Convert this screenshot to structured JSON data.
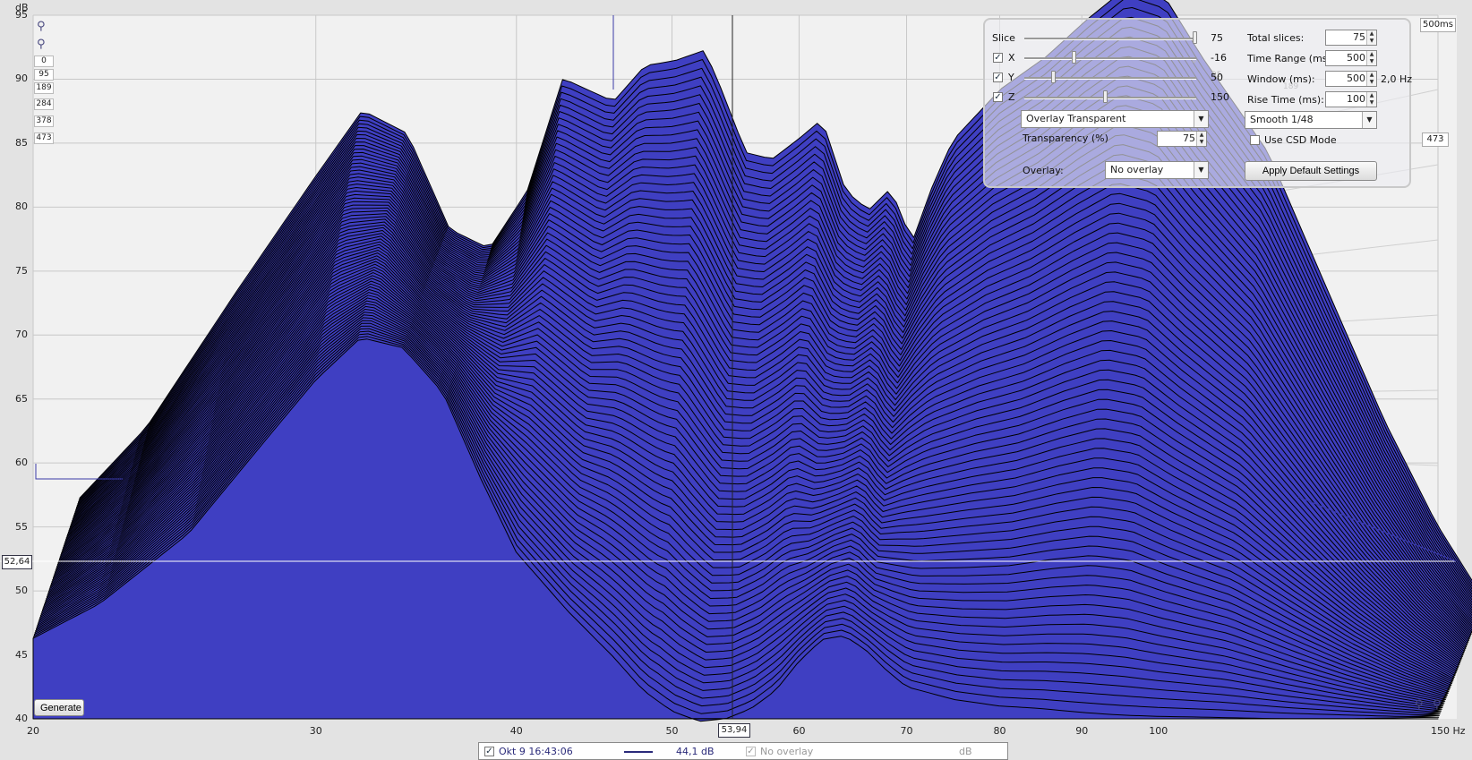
{
  "axes": {
    "y_unit": "dB",
    "y_ticks": [
      "95",
      "90",
      "85",
      "80",
      "75",
      "70",
      "65",
      "60",
      "55",
      "50",
      "45",
      "40"
    ],
    "x_ticks": [
      "20",
      "30",
      "40",
      "50",
      "60",
      "70",
      "80",
      "90",
      "100",
      "150 Hz"
    ],
    "cursor_y": "52,64",
    "cursor_x": "53,94",
    "time_label": "500ms"
  },
  "zoom_boxes": [
    "0",
    "95",
    "189",
    "284",
    "378",
    "473"
  ],
  "right_marker": "473",
  "ghost_labels": {
    "l189": "189",
    "l378": "378",
    "l95": "95",
    "l0": "0"
  },
  "controls": {
    "slice": {
      "label": "Slice",
      "value": "75",
      "level": 1.0
    },
    "x": {
      "label": "X",
      "value": "-16",
      "checked": true,
      "level": 0.28
    },
    "y": {
      "label": "Y",
      "value": "50",
      "checked": true,
      "level": 0.16
    },
    "z": {
      "label": "Z",
      "value": "150",
      "checked": true,
      "level": 0.47
    },
    "overlay_mode": "Overlay Transparent",
    "transparency_label": "Transparency (%)",
    "transparency_value": "75",
    "overlay_label": "Overlay:",
    "overlay_value": "No overlay",
    "total_slices_label": "Total slices:",
    "total_slices_value": "75",
    "time_range_label": "Time Range (ms):",
    "time_range_value": "500",
    "window_label": "Window (ms):",
    "window_value": "500",
    "window_hz": "2,0 Hz",
    "rise_time_label": "Rise Time (ms):",
    "rise_time_value": "100",
    "smoothing": "Smooth 1/48",
    "csd_label": "Use CSD Mode",
    "apply_label": "Apply Default Settings"
  },
  "generate_label": "Generate",
  "legend": {
    "measurement": "Okt 9 16:43:06",
    "level": "44,1 dB",
    "overlay": "No overlay",
    "unit": "dB"
  },
  "colors": {
    "waterfall_fill": "#3f3fc2",
    "background": "#f0f0f0",
    "grid": "#c8c8c8",
    "outline": "#000000"
  },
  "chart_data": {
    "type": "area",
    "x_scale": "log",
    "xlim": [
      20,
      150
    ],
    "ylim": [
      40,
      95
    ],
    "xlabel": "",
    "ylabel": "dB",
    "slices": 75,
    "time_range_ms": 500,
    "front_slice": {
      "x": [
        20,
        22,
        25,
        28,
        30,
        32,
        34,
        36,
        38,
        40,
        43,
        46,
        48,
        50,
        52,
        54,
        56,
        58,
        60,
        62,
        64,
        66,
        68,
        70,
        75,
        80,
        85,
        90,
        95,
        100,
        110,
        120,
        130,
        140,
        150
      ],
      "y": [
        46.3,
        49.0,
        54.5,
        62.0,
        66.5,
        69.8,
        69.0,
        65.5,
        58.8,
        53.0,
        48.5,
        44.8,
        42.2,
        40.6,
        39.8,
        40.0,
        40.8,
        42.2,
        44.5,
        46.2,
        46.5,
        45.4,
        43.8,
        42.5,
        41.5,
        41.0,
        40.8,
        40.5,
        40.3,
        40.2,
        40.1,
        40.0,
        40.0,
        40.0,
        40.0
      ]
    },
    "rear_slice": {
      "x": [
        20,
        22,
        25,
        28,
        30,
        32,
        34,
        36,
        38,
        40,
        43,
        45,
        47,
        49,
        50,
        52,
        54,
        56,
        58,
        60,
        62,
        64,
        66,
        68,
        70,
        75,
        80,
        85,
        90,
        95,
        100,
        110,
        120,
        130,
        140,
        150
      ],
      "y": [
        56.0,
        61.5,
        72.0,
        81.0,
        86.3,
        84.5,
        77.0,
        75.5,
        80.0,
        88.8,
        87.0,
        89.8,
        90.2,
        91.0,
        88.5,
        83.0,
        82.5,
        84.0,
        85.6,
        80.0,
        78.5,
        80.2,
        76.0,
        80.5,
        84.0,
        88.0,
        90.5,
        93.5,
        96.0,
        95.0,
        90.5,
        83.0,
        72.0,
        62.0,
        54.0,
        48.0
      ]
    }
  }
}
